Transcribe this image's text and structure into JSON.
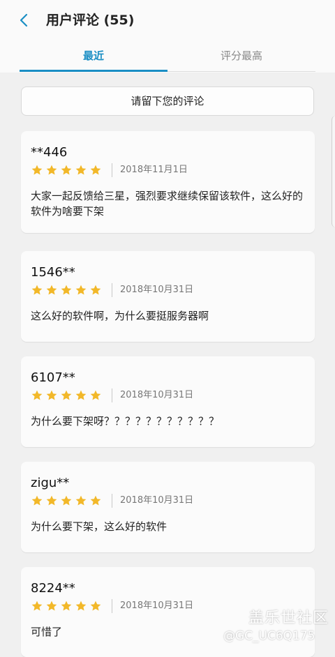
{
  "header": {
    "title": "用户评论 (55)",
    "back_icon": "chevron-left-icon"
  },
  "tabs": [
    {
      "label": "最近",
      "active": true
    },
    {
      "label": "评分最高",
      "active": false
    }
  ],
  "write_review_label": "请留下您的评论",
  "reviews": [
    {
      "author": "**446",
      "rating": 5,
      "date": "2018年11月1日",
      "text": "大家一起反馈给三星，强烈要求继续保留该软件，这么好的软件为啥要下架"
    },
    {
      "author": "1546**",
      "rating": 5,
      "date": "2018年10月31日",
      "text": "这么好的软件啊，为什么要挺服务器啊"
    },
    {
      "author": "6107**",
      "rating": 5,
      "date": "2018年10月31日",
      "text": "为什么要下架呀？？？？？？？？？？？"
    },
    {
      "author": "zigu**",
      "rating": 5,
      "date": "2018年10月31日",
      "text": "为什么要下架，这么好的软件"
    },
    {
      "author": "8224**",
      "rating": 5,
      "date": "2018年10月31日",
      "text": "可惜了"
    }
  ],
  "watermark": {
    "line1": "盖乐世社区",
    "line2": "@GC_UC6Q175"
  },
  "colors": {
    "accent": "#1a8ec4",
    "star": "#f2b829"
  }
}
